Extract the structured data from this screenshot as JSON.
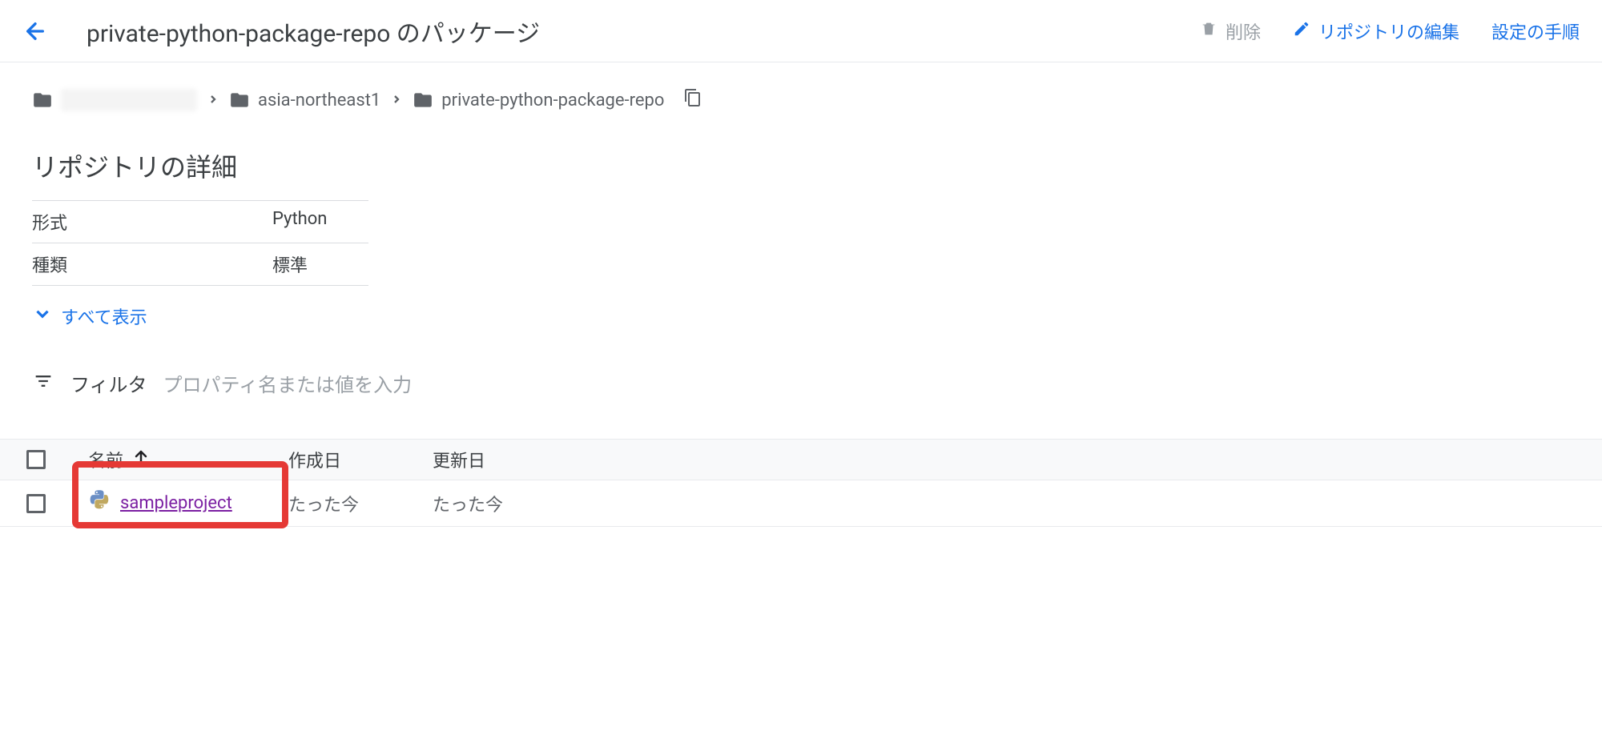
{
  "header": {
    "title": "private-python-package-repo のパッケージ",
    "delete_label": "削除",
    "edit_label": "リポジトリの編集",
    "setup_label": "設定の手順"
  },
  "breadcrumbs": {
    "region": "asia-northeast1",
    "repo": "private-python-package-repo"
  },
  "details": {
    "title": "リポジトリの詳細",
    "format_label": "形式",
    "format_value": "Python",
    "type_label": "種類",
    "type_value": "標準",
    "show_all": "すべて表示"
  },
  "filter": {
    "label": "フィルタ",
    "placeholder": "プロパティ名または値を入力"
  },
  "table": {
    "col_name": "名前",
    "col_created": "作成日",
    "col_updated": "更新日",
    "rows": [
      {
        "name": "sampleproject",
        "created": "たった今",
        "updated": "たった今"
      }
    ]
  }
}
